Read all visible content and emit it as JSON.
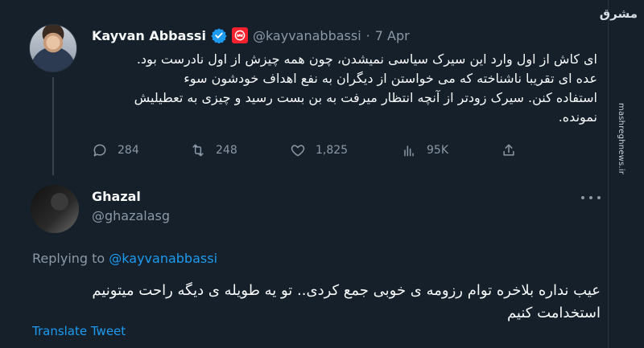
{
  "theme": {
    "background": "#15202b",
    "accent": "#1d9bf0",
    "muted": "#8b98a5",
    "verified": "#1d9bf0",
    "badge": "#f4212e"
  },
  "tweet1": {
    "name": "Kayvan Abbassi",
    "handle": "@kayvanabbassi",
    "separator": "·",
    "date": "7 Apr",
    "icons": {
      "verified": "verified-badge-icon",
      "affiliation": "affiliate-badge-icon"
    },
    "text_lines": [
      "ای کاش از اول وارد این سیرک سیاسی نمیشدن، چون همه چیزش از اول نادرست بود.",
      "عده ای تقریبا ناشناخته که می خواستن از دیگران به نفع اهداف خودشون سوء",
      "استفاده کنن. سیرک زودتر از آنچه انتظار میرفت به بن بست رسید و چیزی به تعطیلیش",
      "نمونده."
    ],
    "actions": {
      "replies": "284",
      "retweets": "248",
      "likes": "1,825",
      "views": "95K"
    }
  },
  "tweet2": {
    "name": "Ghazal",
    "handle": "@ghazalasg",
    "replying_prefix": "Replying to",
    "replying_handle": "@kayvanabbassi",
    "text_lines": [
      "عیب نداره بلاخره توام رزومه ی خوبی جمع کردی.. تو یه طویله ی دیگه راحت میتونیم",
      "استخدامت کنیم"
    ],
    "translate": "Translate Tweet"
  },
  "watermark": {
    "logo": "مشرق",
    "url": "mashreghnews.ir"
  }
}
